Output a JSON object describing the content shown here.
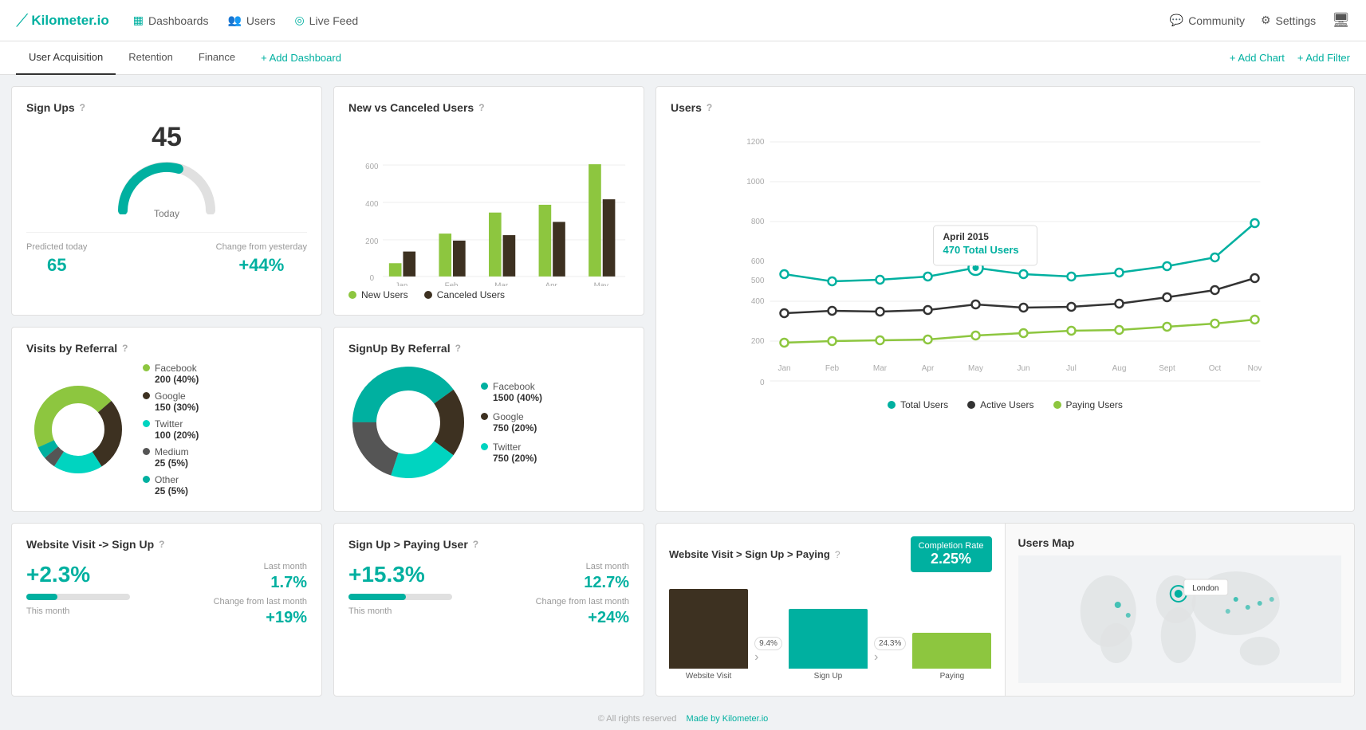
{
  "app": {
    "logo_text": "Kilometer.io",
    "nav": {
      "dashboards": "Dashboards",
      "users": "Users",
      "live_feed": "Live Feed"
    },
    "nav_right": {
      "community": "Community",
      "settings": "Settings"
    },
    "sub_nav": {
      "user_acquisition": "User Acquisition",
      "retention": "Retention",
      "finance": "Finance",
      "add_dashboard": "+ Add Dashboard"
    },
    "actions": {
      "add_chart": "+ Add Chart",
      "add_filter": "+ Add Filter"
    }
  },
  "signups": {
    "title": "Sign Ups",
    "value": 45,
    "label": "Today",
    "predicted_label": "Predicted today",
    "predicted_value": "65",
    "change_label": "Change from yesterday",
    "change_value": "+44%"
  },
  "new_canceled": {
    "title": "New vs Canceled Users",
    "months": [
      "Jan",
      "Feb",
      "Mar",
      "Apr",
      "May"
    ],
    "new_users_label": "New Users",
    "canceled_users_label": "Canceled Users",
    "new_color": "#8dc63f",
    "canceled_color": "#3d3121",
    "y_labels": [
      "0",
      "200",
      "400",
      "600"
    ],
    "new_values": [
      70,
      230,
      340,
      380,
      600
    ],
    "canceled_values": [
      130,
      190,
      220,
      290,
      410
    ]
  },
  "users": {
    "title": "Users",
    "tooltip": {
      "month": "April 2015",
      "value": "470",
      "label": "Total Users"
    },
    "months": [
      "Jan",
      "Feb",
      "Mar",
      "Apr",
      "May",
      "Jun",
      "Jul",
      "Aug",
      "Sept",
      "Oct",
      "Nov"
    ],
    "y_labels": [
      "0",
      "200",
      "400",
      "500",
      "600",
      "800",
      "1000",
      "1200"
    ],
    "series": [
      {
        "name": "Total Users",
        "color": "#00b0a0"
      },
      {
        "name": "Active Users",
        "color": "#333"
      },
      {
        "name": "Paying Users",
        "color": "#8dc63f"
      }
    ],
    "total_values": [
      430,
      390,
      400,
      420,
      470,
      430,
      420,
      440,
      480,
      530,
      760
    ],
    "active_values": [
      260,
      275,
      270,
      280,
      310,
      290,
      295,
      315,
      350,
      390,
      450
    ],
    "paying_values": [
      80,
      90,
      95,
      100,
      120,
      130,
      140,
      145,
      160,
      175,
      195
    ]
  },
  "visits_referral": {
    "title": "Visits by Referral",
    "data": [
      {
        "name": "Facebook",
        "value": "200 (40%)",
        "color": "#8dc63f",
        "pct": 40
      },
      {
        "name": "Google",
        "value": "150 (30%)",
        "color": "#3d3121",
        "pct": 30
      },
      {
        "name": "Twitter",
        "value": "100 (20%)",
        "color": "#00d4c0",
        "pct": 20
      },
      {
        "name": "Medium",
        "value": "25 (5%)",
        "color": "#555",
        "pct": 5
      },
      {
        "name": "Other",
        "value": "25 (5%)",
        "color": "#00b0a0",
        "pct": 5
      }
    ]
  },
  "signup_referral": {
    "title": "SignUp By Referral",
    "data": [
      {
        "name": "Facebook",
        "value": "1500 (40%)",
        "color": "#00b0a0",
        "pct": 40
      },
      {
        "name": "Google",
        "value": "750 (20%)",
        "color": "#3d3121",
        "pct": 20
      },
      {
        "name": "Twitter",
        "value": "750 (20%)",
        "color": "#00d4c0",
        "pct": 20
      }
    ]
  },
  "website_signup": {
    "title": "Website Visit -> Sign Up",
    "this_month_value": "+2.3%",
    "this_month_label": "This month",
    "bar_pct": 30,
    "last_month_label": "Last month",
    "last_month_value": "1.7%",
    "change_label": "Change from last month",
    "change_value": "+19%"
  },
  "signup_paying": {
    "title": "Sign Up > Paying User",
    "this_month_value": "+15.3%",
    "this_month_label": "This month",
    "bar_pct": 55,
    "last_month_label": "Last month",
    "last_month_value": "12.7%",
    "change_label": "Change from last month",
    "change_value": "+24%"
  },
  "funnel": {
    "title": "Website Visit > Sign Up > Paying",
    "completion_rate_label": "Completion Rate",
    "completion_rate_value": "2.25%",
    "steps": [
      {
        "label": "Website Visit",
        "value": 100,
        "arrow": "9.4%"
      },
      {
        "label": "Sign Up",
        "value": 75,
        "arrow": "24.3%"
      },
      {
        "label": "Paying",
        "value": 40
      }
    ],
    "bar_colors": [
      "#3d3121",
      "#00b0a0",
      "#8dc63f"
    ]
  },
  "map": {
    "title": "Users Map",
    "tooltip": "London"
  },
  "footer": {
    "copyright": "© All rights reserved",
    "made_by": "Made by Kilometer.io"
  }
}
